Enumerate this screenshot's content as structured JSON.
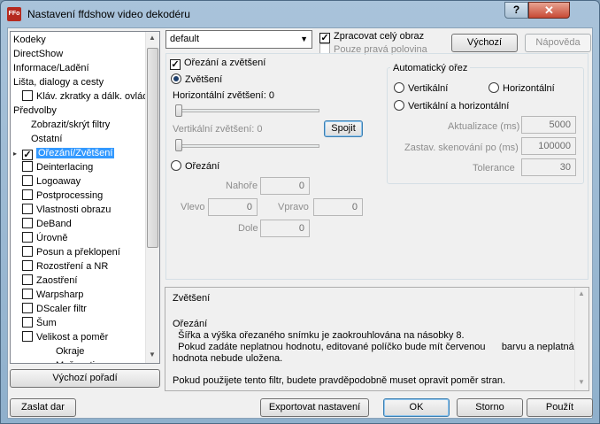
{
  "window": {
    "title": "Nastavení ffdshow video dekodéru",
    "app_icon": "ffdshow-icon",
    "help_glyph": "?",
    "close_glyph": "✕"
  },
  "tree": {
    "items": [
      {
        "label": "Kodeky"
      },
      {
        "label": "DirectShow"
      },
      {
        "label": "Informace/Ladění"
      },
      {
        "label": "Lišta, dialogy a cesty"
      },
      {
        "label": "Kláv. zkratky a dálk. ovládání",
        "checkbox": true,
        "checked": false
      },
      {
        "label": "Předvolby"
      },
      {
        "label": "Zobrazit/skrýt filtry"
      },
      {
        "label": "Ostatní"
      },
      {
        "label": "Ořezání/Zvětšení",
        "checkbox": true,
        "checked": true,
        "selected": true
      },
      {
        "label": "Deinterlacing",
        "checkbox": true,
        "checked": false
      },
      {
        "label": "Logoaway",
        "checkbox": true,
        "checked": false
      },
      {
        "label": "Postprocessing",
        "checkbox": true,
        "checked": false
      },
      {
        "label": "Vlastnosti obrazu",
        "checkbox": true,
        "checked": false
      },
      {
        "label": "DeBand",
        "checkbox": true,
        "checked": false
      },
      {
        "label": "Úrovně",
        "checkbox": true,
        "checked": false
      },
      {
        "label": "Posun a překlopení",
        "checkbox": true,
        "checked": false
      },
      {
        "label": "Rozostření a NR",
        "checkbox": true,
        "checked": false
      },
      {
        "label": "Zaostření",
        "checkbox": true,
        "checked": false
      },
      {
        "label": "Warpsharp",
        "checkbox": true,
        "checked": false
      },
      {
        "label": "DScaler filtr",
        "checkbox": true,
        "checked": false
      },
      {
        "label": "Šum",
        "checkbox": true,
        "checked": false
      },
      {
        "label": "Velikost a poměr",
        "checkbox": true,
        "checked": false
      },
      {
        "label": "Okraje"
      },
      {
        "label": "Možnosti"
      }
    ],
    "default_order_button": "Výchozí pořadí"
  },
  "top": {
    "preset_value": "default",
    "process_whole_label": "Zpracovat celý obraz",
    "process_whole_checked": true,
    "right_half_label": "Pouze pravá polovina",
    "right_half_checked": false,
    "default_button": "Výchozí",
    "help_button": "Nápověda"
  },
  "crop": {
    "enable_label": "Ořezání a zvětšení",
    "enable_checked": true,
    "zoom_radio": "Zvětšení",
    "zoom_selected": true,
    "horizontal_zoom_label": "Horizontální zvětšení: 0",
    "horizontal_zoom_value": 0,
    "vertical_zoom_label": "Vertikální zvětšení: 0",
    "vertical_zoom_value": 0,
    "link_button": "Spojit",
    "crop_radio": "Ořezání",
    "crop_selected": false,
    "top_label": "Nahoře",
    "top_value": "0",
    "left_label": "Vlevo",
    "left_value": "0",
    "right_label": "Vpravo",
    "right_value": "0",
    "bottom_label": "Dole",
    "bottom_value": "0"
  },
  "autocrop": {
    "title": "Automatický ořez",
    "vertical": "Vertikální",
    "horizontal": "Horizontální",
    "both": "Vertikální a horizontální",
    "update_label": "Aktualizace (ms)",
    "update_value": "5000",
    "stop_label": "Zastav. skenování po (ms)",
    "stop_value": "100000",
    "tolerance_label": "Tolerance",
    "tolerance_value": "30"
  },
  "description": {
    "line1": "Zvětšení",
    "line2": "Ořezání",
    "line3": "  Šířka a výška ořezaného snímku je zaokrouhlována na násobky 8.",
    "line4": "  Pokud zadáte neplatnou hodnotu, editované políčko bude mít červenou      barvu a neplatná",
    "line5": "hodnota nebude uložena.",
    "line6": "Pokud použijete tento filtr, budete pravděpodobně muset opravit poměr stran."
  },
  "bottom": {
    "donate": "Zaslat dar",
    "export": "Exportovat nastavení",
    "ok": "OK",
    "cancel": "Storno",
    "apply": "Použít"
  }
}
